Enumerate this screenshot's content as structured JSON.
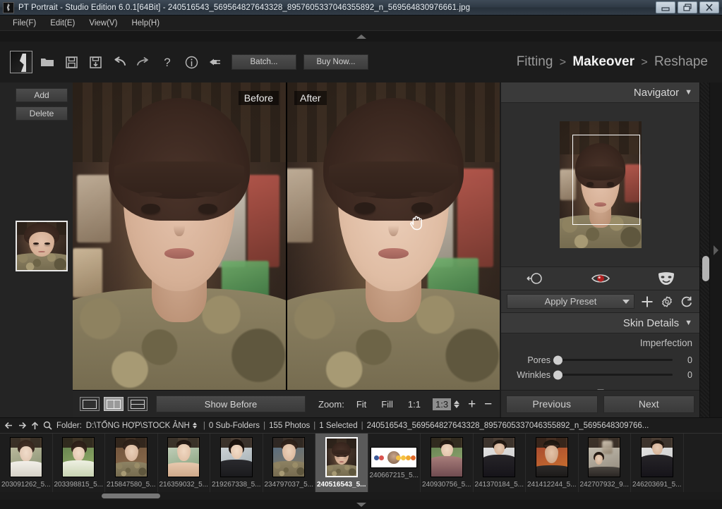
{
  "window": {
    "title": "PT Portrait - Studio Edition 6.0.1[64Bit] - 240516543_569564827643328_8957605337046355892_n_569564830976661.jpg",
    "app_icon": "app-logo-icon",
    "minimize": "—",
    "restore": "❐",
    "close": "✕"
  },
  "menubar": {
    "items": [
      {
        "label": "File(F)"
      },
      {
        "label": "Edit(E)"
      },
      {
        "label": "View(V)"
      },
      {
        "label": "Help(H)"
      }
    ]
  },
  "toolbar": {
    "icons": [
      {
        "name": "open-folder-icon",
        "title": "Open"
      },
      {
        "name": "save-icon",
        "title": "Save"
      },
      {
        "name": "save-as-icon",
        "title": "Save As"
      },
      {
        "name": "undo-icon",
        "title": "Undo"
      },
      {
        "name": "redo-icon",
        "title": "Redo"
      },
      {
        "name": "help-icon",
        "title": "Help"
      },
      {
        "name": "info-icon",
        "title": "Info"
      },
      {
        "name": "plugin-icon",
        "title": "Plug-in"
      }
    ],
    "batch_label": "Batch...",
    "buy_label": "Buy Now..."
  },
  "breadcrumb": {
    "first": "Fitting",
    "current": "Makeover",
    "last": "Reshape",
    "separator": ">"
  },
  "sidebar": {
    "add_label": "Add",
    "delete_label": "Delete",
    "collapse_icon": "chevron-left-icon"
  },
  "viewer": {
    "before_label": "Before",
    "after_label": "After",
    "cursor": "hand-cursor"
  },
  "viewbar": {
    "layouts": [
      {
        "name": "layout-single",
        "active": false
      },
      {
        "name": "layout-side-by-side",
        "active": true
      },
      {
        "name": "layout-stacked",
        "active": false
      }
    ],
    "show_before_label": "Show Before",
    "zoom_label": "Zoom:",
    "zoom_options": [
      {
        "label": "Fit",
        "selected": false
      },
      {
        "label": "Fill",
        "selected": false
      },
      {
        "label": "1:1",
        "selected": false
      },
      {
        "label": "1:3",
        "selected": true
      }
    ],
    "zoom_in": "+",
    "zoom_out": "−"
  },
  "navigator": {
    "title": "Navigator",
    "caret": "▼"
  },
  "tools": [
    {
      "name": "spot-removal-icon",
      "title": "Spot Removal"
    },
    {
      "name": "red-eye-icon",
      "title": "Red Eye"
    },
    {
      "name": "makeover-mask-icon",
      "title": "Makeover Mask"
    }
  ],
  "preset": {
    "label": "Apply Preset",
    "caret": "▼",
    "add_icon": "plus-icon",
    "settings_icon": "gear-icon",
    "reset_icon": "reset-icon"
  },
  "skin_details": {
    "title": "Skin Details",
    "caret": "▼",
    "group_label": "Imperfection",
    "sliders": [
      {
        "label": "Pores",
        "value": "0"
      },
      {
        "label": "Wrinkles",
        "value": "0"
      }
    ]
  },
  "navigation": {
    "previous_label": "Previous",
    "next_label": "Next"
  },
  "statusbar": {
    "back_icon": "arrow-left-icon",
    "forward_icon": "arrow-right-icon",
    "up_icon": "arrow-up-icon",
    "search_icon": "search-icon",
    "folder_label": "Folder:",
    "folder_path": "D:\\TỔNG HỢP\\STOCK ẢNH",
    "subfolders": "0 Sub-Folders",
    "photos": "155 Photos",
    "selected": "1 Selected",
    "filename": "240516543_569564827643328_8957605337046355892_n_5695648309766...",
    "separator": "|"
  },
  "filmstrip": {
    "items": [
      {
        "name": "203091262_5...",
        "selected": false,
        "kind": "portrait"
      },
      {
        "name": "203398815_5...",
        "selected": false,
        "kind": "portrait"
      },
      {
        "name": "215847580_5...",
        "selected": false,
        "kind": "portrait"
      },
      {
        "name": "216359032_5...",
        "selected": false,
        "kind": "portrait"
      },
      {
        "name": "219267338_5...",
        "selected": false,
        "kind": "portrait"
      },
      {
        "name": "234797037_5...",
        "selected": false,
        "kind": "portrait"
      },
      {
        "name": "240516543_5...",
        "selected": true,
        "kind": "portrait"
      },
      {
        "name": "240667215_5...",
        "selected": false,
        "kind": "wide"
      },
      {
        "name": "240930756_5...",
        "selected": false,
        "kind": "portrait"
      },
      {
        "name": "241370184_5...",
        "selected": false,
        "kind": "portrait"
      },
      {
        "name": "241412244_5...",
        "selected": false,
        "kind": "portrait"
      },
      {
        "name": "242707932_9...",
        "selected": false,
        "kind": "portrait"
      },
      {
        "name": "246203691_5...",
        "selected": false,
        "kind": "portrait"
      }
    ]
  },
  "colors": {
    "panel_bg": "#2e2e2e",
    "toolbar_bg": "#1c1c1c",
    "header_bg": "#3a3a3a",
    "accent_text": "#f2f2f2",
    "title_gradient_top": "#3e4a57",
    "selection": "#5a5a5a"
  }
}
